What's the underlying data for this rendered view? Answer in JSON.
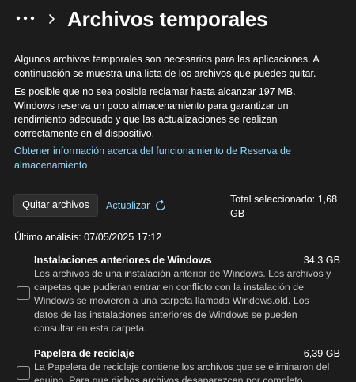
{
  "header": {
    "title": "Archivos temporales",
    "more_icon": "more-horizontal-icon",
    "breadcrumb_separator_icon": "chevron-right-icon"
  },
  "intro": {
    "paragraph_1": "Algunos archivos temporales son necesarios para las aplicaciones. A continuación se muestra una lista de los archivos que puedes quitar.",
    "paragraph_2": "Es posible que no sea posible reclamar hasta alcanzar 197 MB. Windows reserva un poco almacenamiento para garantizar un rendimiento adecuado y que las actualizaciones se realizan correctamente en el dispositivo.",
    "link": "Obtener información acerca del funcionamiento de Reserva de almacenamiento"
  },
  "toolbar": {
    "remove_label": "Quitar archivos",
    "refresh_label": "Actualizar",
    "refresh_icon": "refresh-icon",
    "total_selected": "Total seleccionado: 1,68 GB"
  },
  "last_scan": "Último análisis: 07/05/2025 17:12",
  "items": [
    {
      "title": "Instalaciones anteriores de Windows",
      "size": "34,3 GB",
      "description": "Los archivos de una instalación anterior de Windows. Los archivos y carpetas que pudieran entrar en conflicto con la instalación de Windows se movieron a una carpeta llamada Windows.old. Los datos de las instalaciones anteriores de Windows se pueden consultar en esta carpeta.",
      "checked": false
    },
    {
      "title": "Papelera de reciclaje",
      "size": "6,39 GB",
      "description": "La Papelera de reciclaje contiene los archivos que se eliminaron del equipo. Para que dichos archivos desaparezcan por completo",
      "checked": false
    }
  ],
  "colors": {
    "background": "#1c1c1c",
    "accent": "#8fd7ff",
    "button_bg": "#2d2d2d",
    "secondary_text": "#c8c8c8"
  }
}
